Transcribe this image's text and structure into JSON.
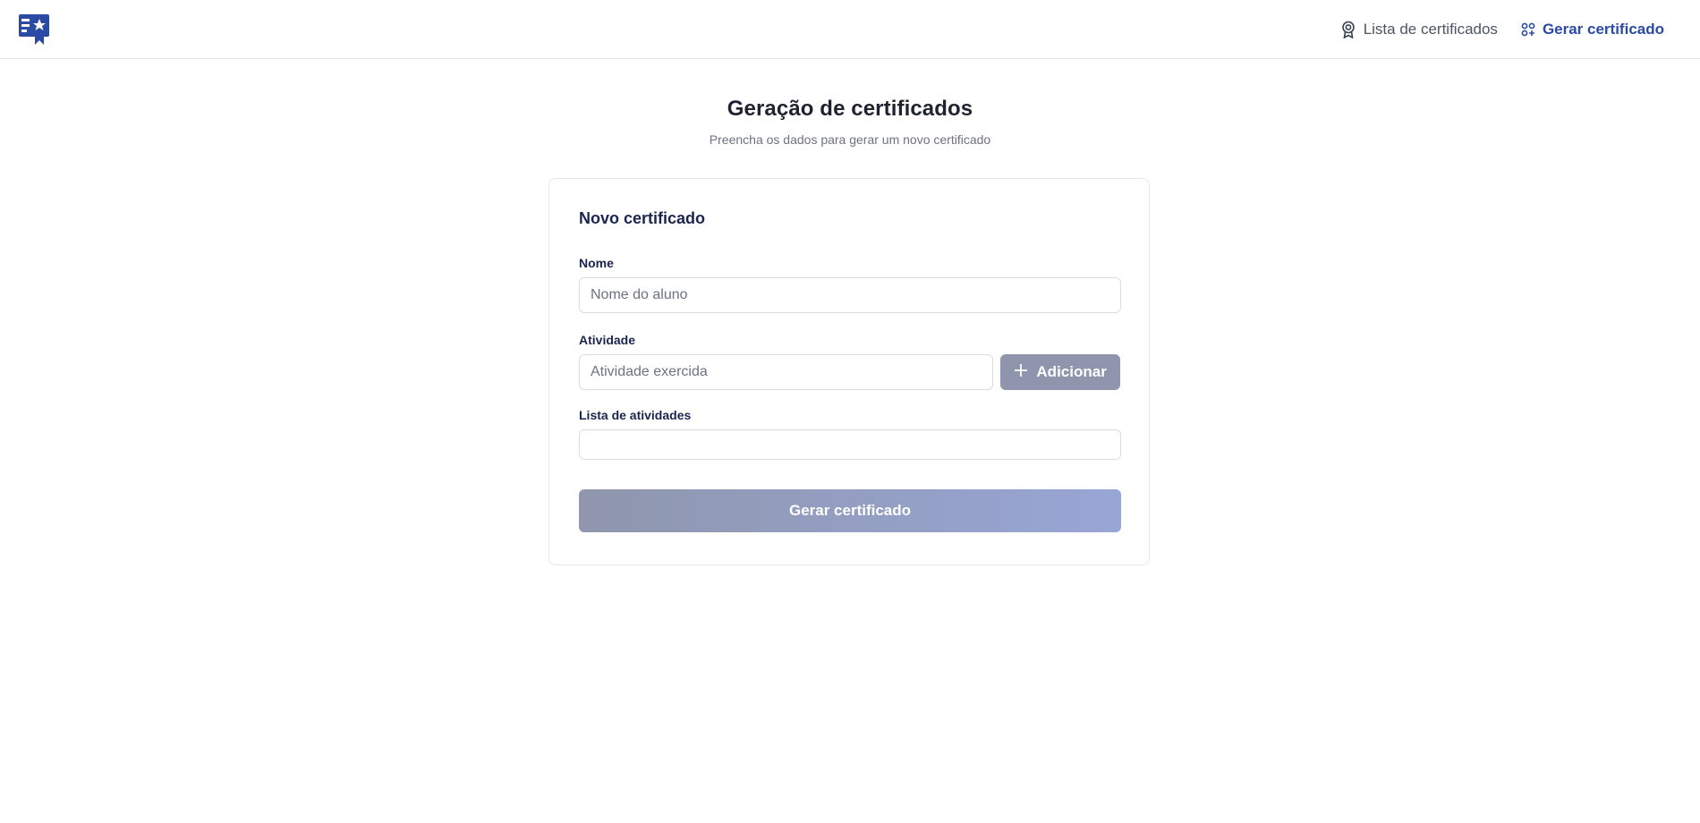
{
  "app": {
    "logo_icon": "certificate-ribbon-icon",
    "brand_color": "#2b4aa3"
  },
  "nav": {
    "items": [
      {
        "label": "Lista de certificados",
        "icon": "award-icon",
        "active": false
      },
      {
        "label": "Gerar certificado",
        "icon": "grid-icon",
        "active": true
      }
    ]
  },
  "header": {
    "title": "Geração de certificados",
    "subtitle": "Preencha os dados para gerar um novo certificado"
  },
  "form": {
    "title": "Novo certificado",
    "name_label": "Nome",
    "name_placeholder": "Nome do aluno",
    "name_value": "",
    "activity_label": "Atividade",
    "activity_placeholder": "Atividade exercida",
    "activity_value": "",
    "add_button_label": "Adicionar",
    "activities_label": "Lista de atividades",
    "activities": [],
    "submit_label": "Gerar certificado"
  }
}
